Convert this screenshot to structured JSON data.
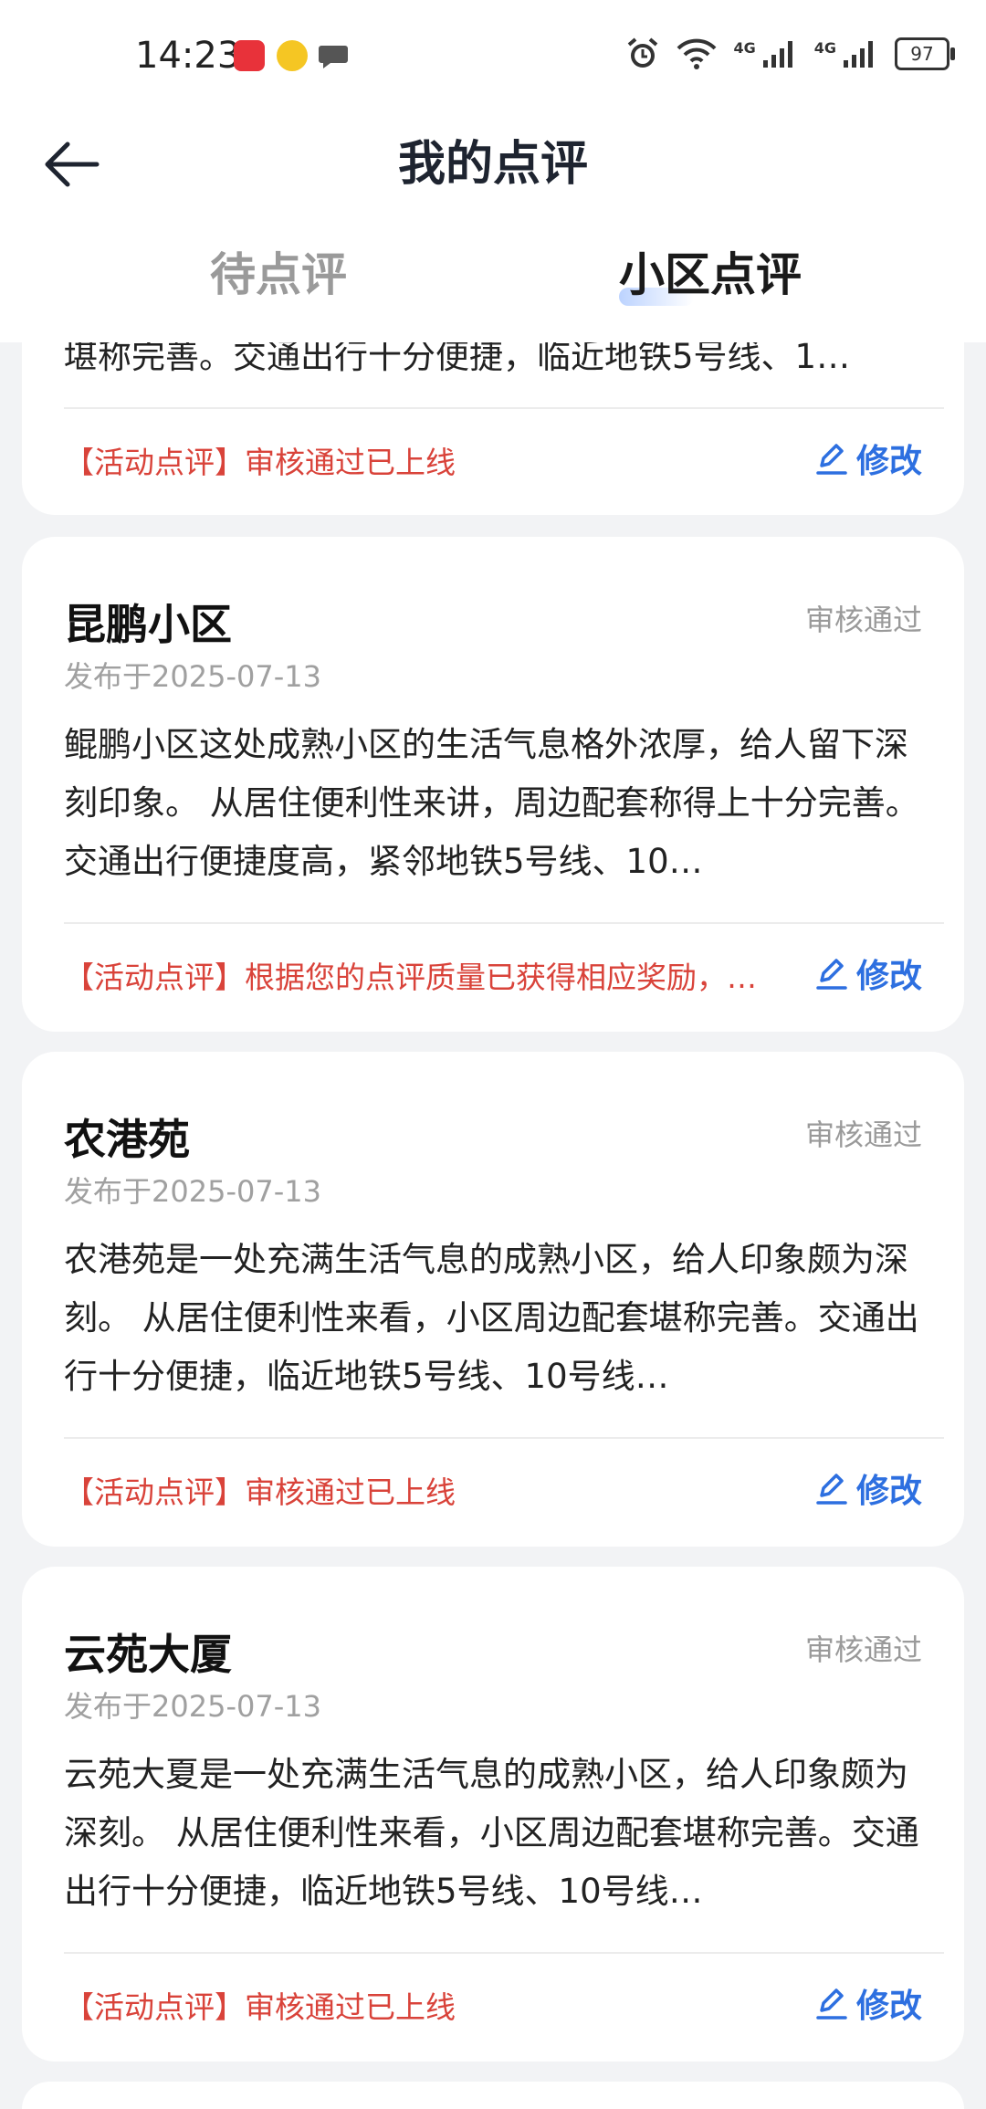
{
  "status_bar": {
    "time": "14:23",
    "battery": "97",
    "network_labels": [
      "4G",
      "4G"
    ]
  },
  "header": {
    "title": "我的点评"
  },
  "tabs": [
    {
      "label": "待点评",
      "active": false
    },
    {
      "label": "小区点评",
      "active": true
    }
  ],
  "partial_card": {
    "body_fragment": "堪称完善。交通出行十分便捷，临近地铁5号线、1…",
    "note": "【活动点评】审核通过已上线",
    "edit_label": "修改"
  },
  "reviews": [
    {
      "title": "昆鹏小区",
      "status": "审核通过",
      "date": "发布于2025-07-13",
      "body": "鲲鹏小区这处成熟小区的生活气息格外浓厚，给人留下深刻印象。 从居住便利性来讲，周边配套称得上十分完善。交通出行便捷度高，紧邻地铁5号线、10…",
      "note": "【活动点评】根据您的点评质量已获得相应奖励，…",
      "edit_label": "修改"
    },
    {
      "title": "农港苑",
      "status": "审核通过",
      "date": "发布于2025-07-13",
      "body": "农港苑是一处充满生活气息的成熟小区，给人印象颇为深刻。 从居住便利性来看，小区周边配套堪称完善。交通出行十分便捷，临近地铁5号线、10号线…",
      "note": "【活动点评】审核通过已上线",
      "edit_label": "修改"
    },
    {
      "title": "云苑大厦",
      "status": "审核通过",
      "date": "发布于2025-07-13",
      "body": "云苑大夏是一处充满生活气息的成熟小区，给人印象颇为深刻。 从居住便利性来看，小区周边配套堪称完善。交通出行十分便捷，临近地铁5号线、10号线…",
      "note": "【活动点评】审核通过已上线",
      "edit_label": "修改"
    }
  ],
  "colors": {
    "accent": "#2d6fe0",
    "note_red": "#d9433a",
    "background": "#f2f3f5"
  }
}
